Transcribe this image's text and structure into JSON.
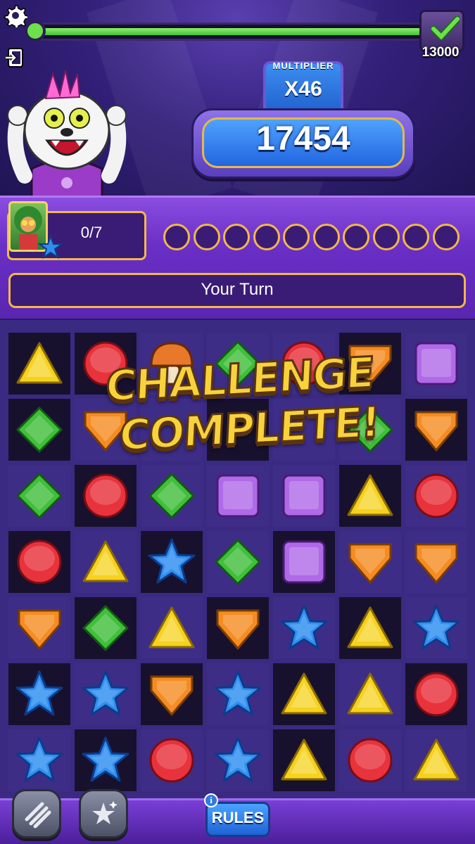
{
  "header": {
    "settings_icon": "gear-icon",
    "exit_icon": "exit-icon",
    "progress_fraction": 0.98,
    "goal_value": "13000",
    "goal_icon": "checkmark-icon"
  },
  "score": {
    "multiplier_label": "MULTIPLIER",
    "multiplier_value": "X46",
    "value": "17454"
  },
  "player": {
    "card_progress": "0/7",
    "slot_count": 10,
    "turn_text": "Your Turn"
  },
  "banner": {
    "line1": "CHALLENGE",
    "line2": "COMPLETE!"
  },
  "board": {
    "cols": 7,
    "rows": 7,
    "grid": [
      [
        "triangle",
        "circle",
        "mushroom",
        "diamond",
        "circle",
        "shield",
        "square"
      ],
      [
        "diamond",
        "shield",
        "",
        "",
        "",
        "diamond",
        "shield"
      ],
      [
        "diamond",
        "circle",
        "diamond",
        "square",
        "square",
        "triangle",
        "circle"
      ],
      [
        "circle",
        "triangle",
        "star",
        "diamond",
        "square",
        "shield",
        "shield"
      ],
      [
        "shield",
        "diamond",
        "triangle",
        "shield",
        "star",
        "triangle",
        "star"
      ],
      [
        "star",
        "star",
        "shield",
        "star",
        "triangle",
        "triangle",
        "circle"
      ],
      [
        "star",
        "star",
        "circle",
        "star",
        "triangle",
        "circle",
        "triangle"
      ]
    ],
    "dark_cells": [
      [
        1,
        1,
        0,
        0,
        0,
        1,
        0
      ],
      [
        1,
        0,
        0,
        1,
        0,
        0,
        1
      ],
      [
        0,
        1,
        0,
        0,
        0,
        1,
        0
      ],
      [
        1,
        0,
        1,
        0,
        1,
        0,
        0
      ],
      [
        0,
        1,
        0,
        1,
        0,
        1,
        0
      ],
      [
        1,
        0,
        1,
        0,
        1,
        0,
        1
      ],
      [
        0,
        1,
        0,
        0,
        1,
        0,
        0
      ]
    ],
    "colors": {
      "triangle": "#f6d21e",
      "circle": "#e8323c",
      "diamond": "#3fbf3a",
      "shield": "#f58c22",
      "square": "#b06ae8",
      "star": "#2f8ff0",
      "mushroom": "#e8782a"
    }
  },
  "footer": {
    "power1_icon": "swipe-power-icon",
    "power2_icon": "sparkle-stars-icon",
    "rules_label": "RULES",
    "info_icon": "i"
  }
}
